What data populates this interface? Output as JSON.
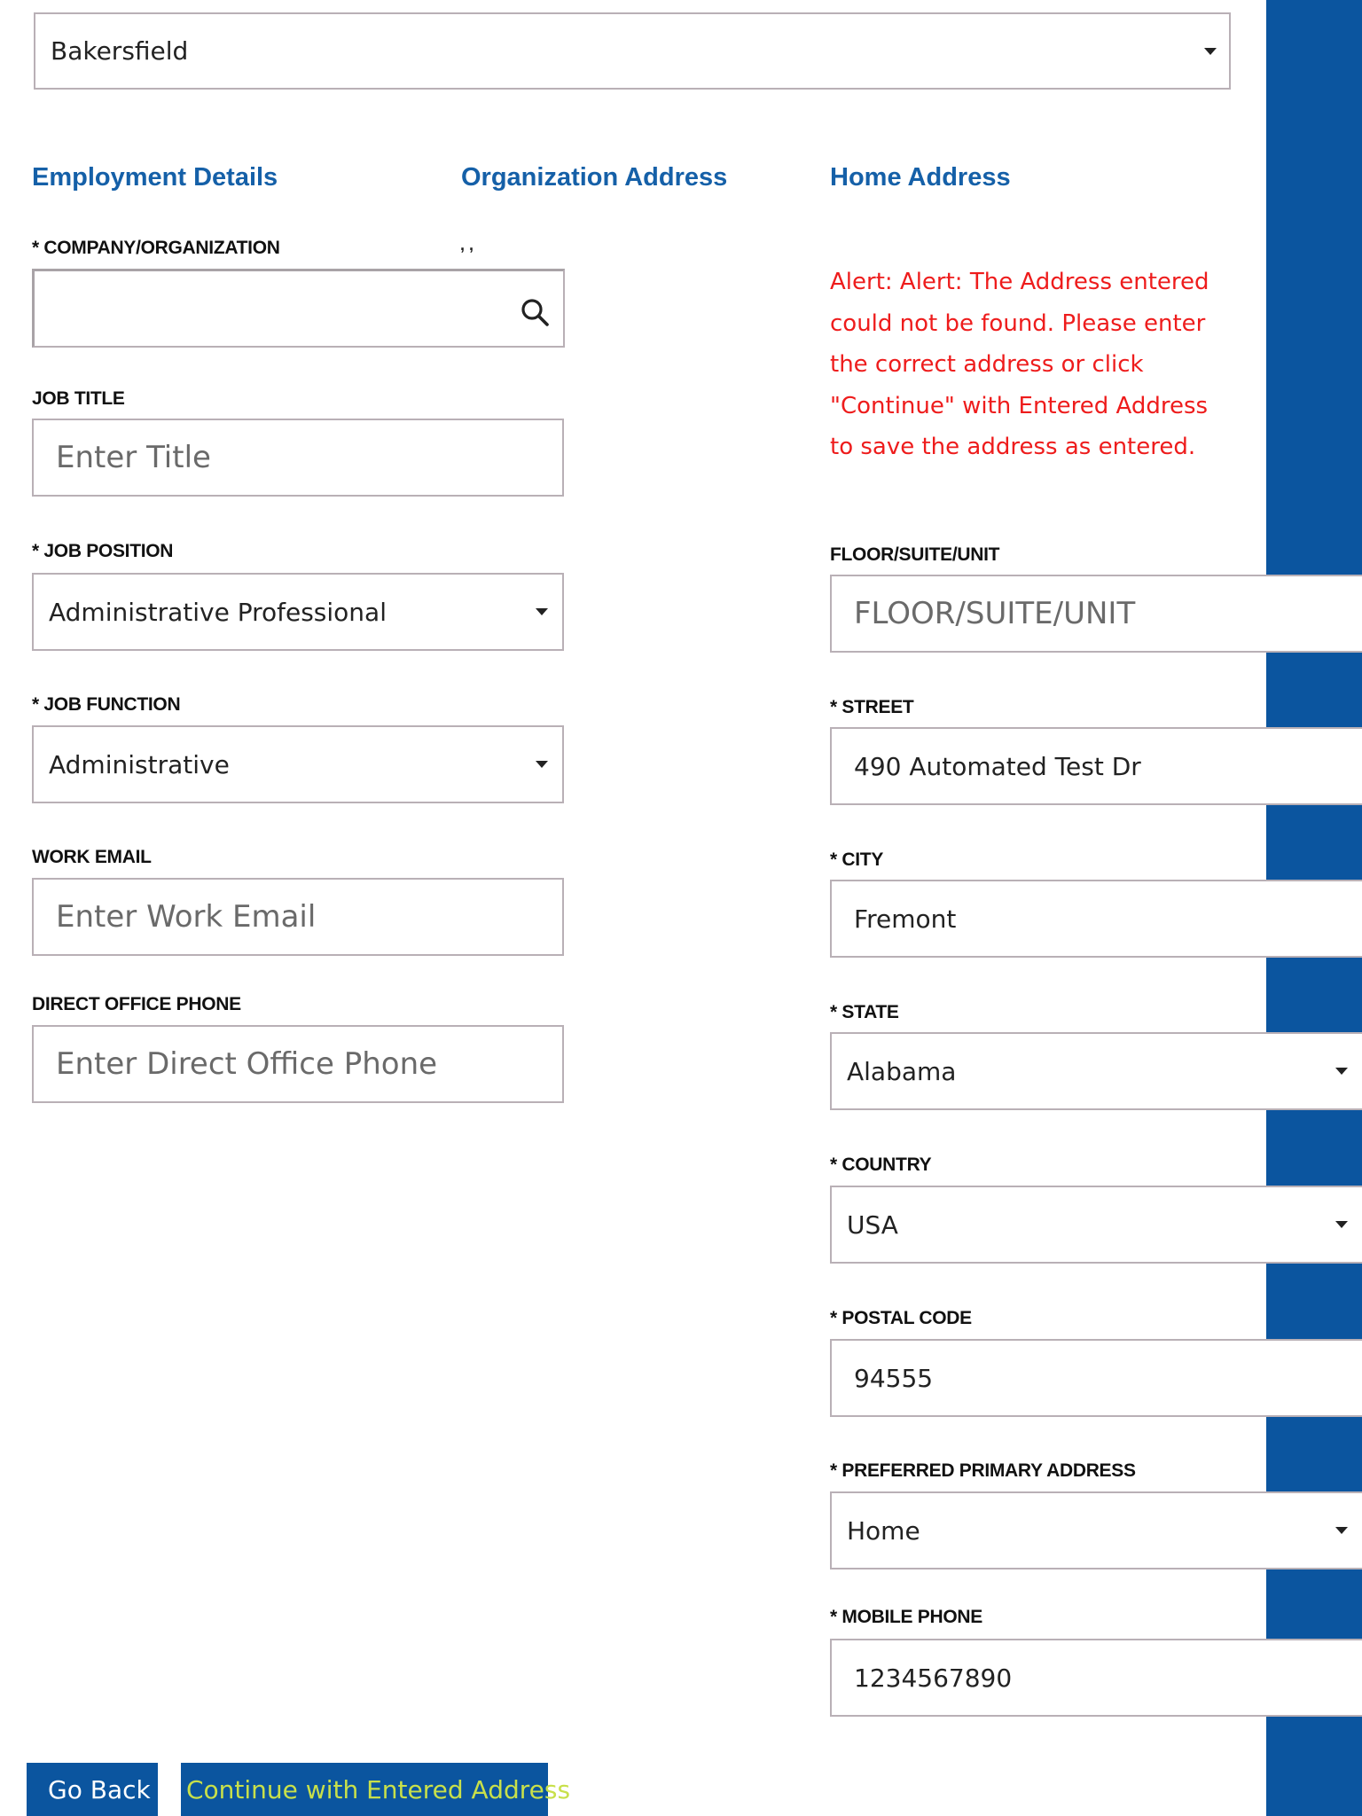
{
  "top_select": {
    "value": "Bakersfield"
  },
  "headings": {
    "employment": "Employment Details",
    "organization": "Organization Address",
    "home": "Home Address"
  },
  "org_address": {
    "line1": ", ,",
    "line2": ", ,"
  },
  "employment": {
    "company": {
      "label": "* COMPANY/ORGANIZATION",
      "value": ""
    },
    "job_title": {
      "label": "JOB TITLE",
      "placeholder": "Enter Title"
    },
    "job_position": {
      "label": "* JOB POSITION",
      "value": "Administrative Professional"
    },
    "job_function": {
      "label": "* JOB FUNCTION",
      "value": "Administrative"
    },
    "work_email": {
      "label": "WORK EMAIL",
      "placeholder": "Enter Work Email"
    },
    "office_phone": {
      "label": "DIRECT OFFICE PHONE",
      "placeholder": "Enter Direct Office Phone"
    }
  },
  "home": {
    "alert": "Alert: Alert: The Address entered could not be found. Please enter the correct address or click \"Continue\" with Entered Address to save the address as entered.",
    "floor": {
      "label": "FLOOR/SUITE/UNIT",
      "placeholder": "FLOOR/SUITE/UNIT"
    },
    "street": {
      "label": "* STREET",
      "value": "490 Automated Test Dr"
    },
    "city": {
      "label": "* CITY",
      "value": "Fremont"
    },
    "state": {
      "label": "* STATE",
      "value": "Alabama"
    },
    "country": {
      "label": "* COUNTRY",
      "value": "USA"
    },
    "postal": {
      "label": "* POSTAL CODE",
      "value": "94555"
    },
    "preferred": {
      "label": "* PREFERRED PRIMARY ADDRESS",
      "value": "Home"
    },
    "mobile": {
      "label": "* MOBILE PHONE",
      "value": "1234567890"
    }
  },
  "buttons": {
    "go_back": "Go Back",
    "continue": "Continue with Entered Address"
  },
  "colors": {
    "accent_blue": "#0b559f",
    "heading_blue": "#1560a8",
    "alert_red": "#ee1c1c",
    "continue_text": "#c8e04a"
  },
  "icons": {
    "search": "search-icon",
    "dropdown": "chevron-down-icon"
  }
}
